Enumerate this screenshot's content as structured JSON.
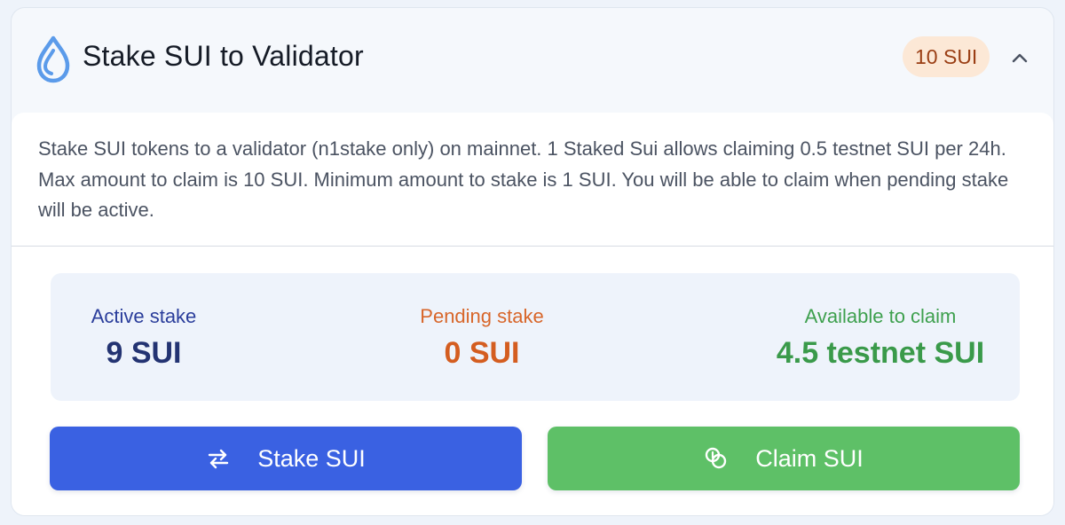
{
  "header": {
    "title": "Stake SUI to Validator",
    "amount_badge": "10 SUI",
    "icon": "sui-drop-icon",
    "collapse_icon": "chevron-up-icon"
  },
  "description": "Stake SUI tokens to a validator (n1stake only) on mainnet. 1 Staked Sui allows claiming 0.5 testnet SUI per 24h. Max amount to claim is 10 SUI. Minimum amount to stake is 1 SUI. You will be able to claim when pending stake will be active.",
  "stats": {
    "active": {
      "label": "Active stake",
      "value": "9 SUI",
      "color": "#233372"
    },
    "pending": {
      "label": "Pending stake",
      "value": "0 SUI",
      "color": "#d45d20"
    },
    "available": {
      "label": "Available to claim",
      "value": "4.5 testnet SUI",
      "color": "#3a9a4a"
    }
  },
  "actions": {
    "stake": {
      "label": "Stake SUI",
      "icon": "swap-arrows-icon",
      "color": "#3a61e2"
    },
    "claim": {
      "label": "Claim SUI",
      "icon": "coins-icon",
      "color": "#5ec067"
    }
  }
}
